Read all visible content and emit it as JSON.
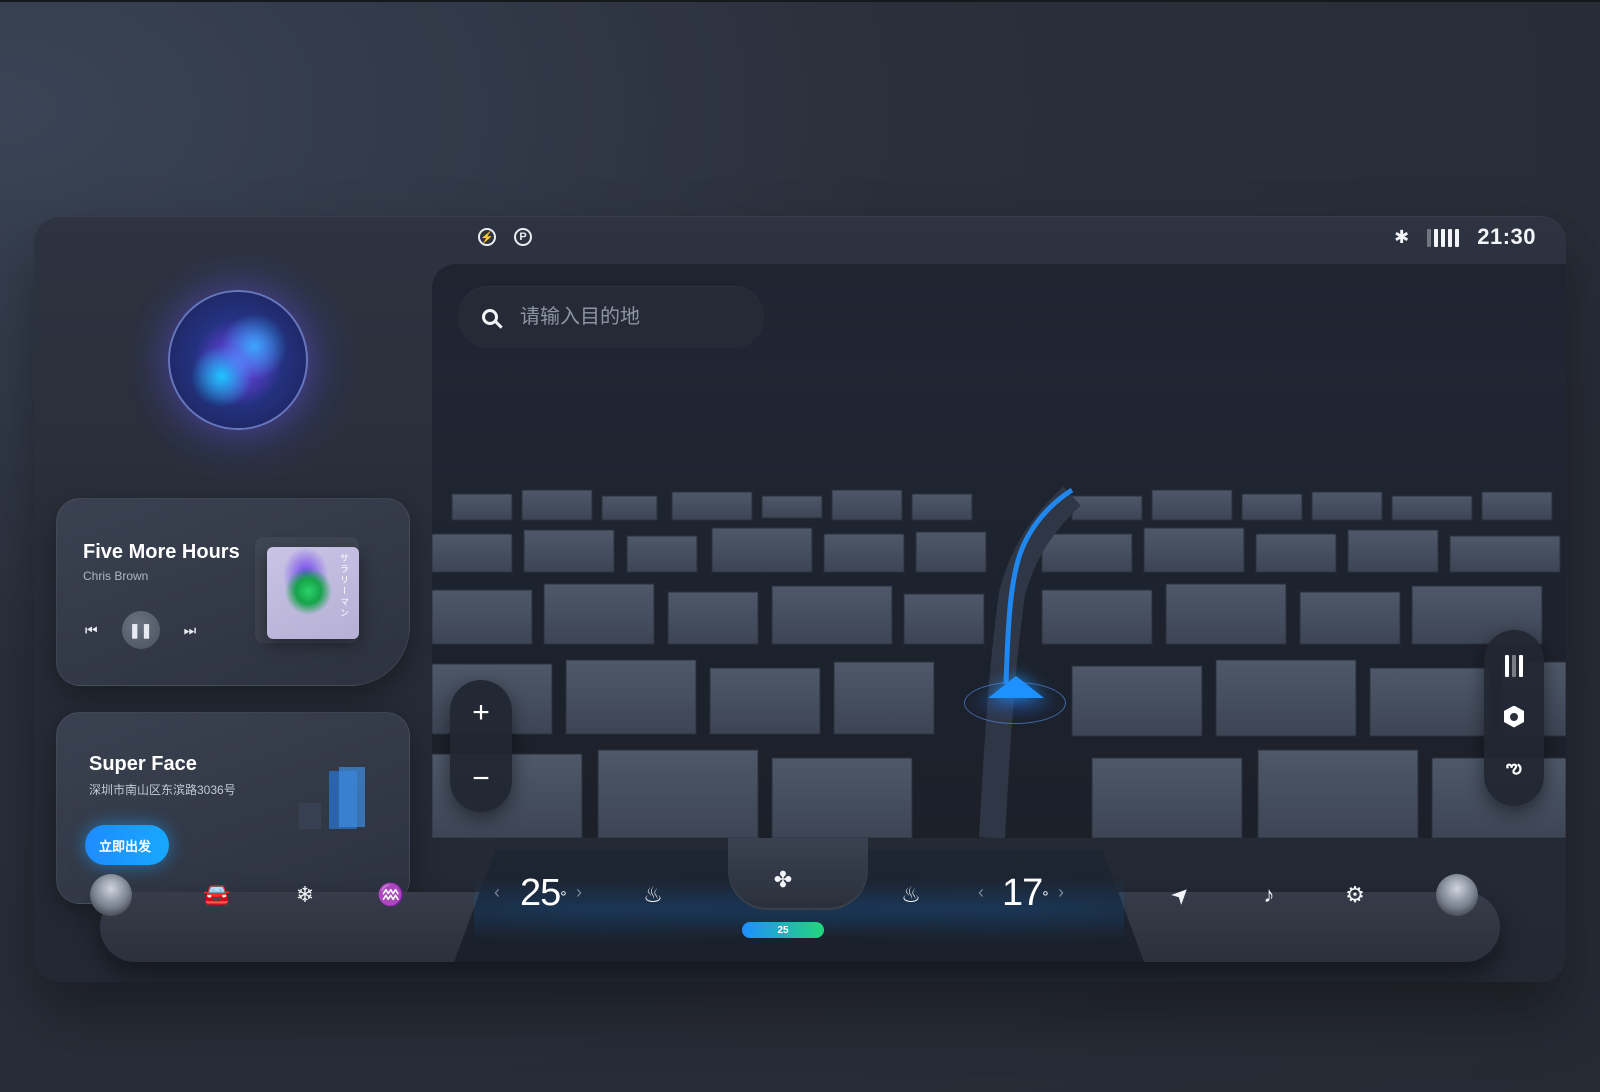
{
  "status": {
    "left_icons": [
      "charging-icon",
      "parking-icon"
    ],
    "charging_glyph": "⚡",
    "parking_glyph": "P",
    "bluetooth_glyph": "✱",
    "time": "21:30"
  },
  "music": {
    "title": "Five More Hours",
    "artist": "Chris Brown",
    "album_text": "サラリーマン",
    "prev_glyph": "⏮",
    "pause_glyph": "❚❚",
    "next_glyph": "⏭"
  },
  "place": {
    "title": "Super Face",
    "address": "深圳市南山区东滨路3036号",
    "go_label": "立即出发"
  },
  "map": {
    "search_placeholder": "请输入目的地",
    "zoom_in": "+",
    "zoom_out": "−",
    "route_glyph": "ఌ"
  },
  "dock": {
    "car_glyph": "🚘",
    "front_defrost_glyph": "❄",
    "rear_defrost_glyph": "♒",
    "left_temp": "25",
    "right_temp": "17",
    "degree": "°",
    "chev_left": "‹",
    "chev_right": "›",
    "seat_left_glyph": "♨",
    "seat_right_glyph": "♨",
    "fan_glyph": "✤",
    "fan_level": "25",
    "navigate_glyph": "➤",
    "music_glyph": "♪",
    "settings_glyph": "⚙"
  },
  "colors": {
    "accent_blue": "#1e90ff",
    "fan_gradient_end": "#22d67a",
    "background": "#2a2f3b"
  }
}
